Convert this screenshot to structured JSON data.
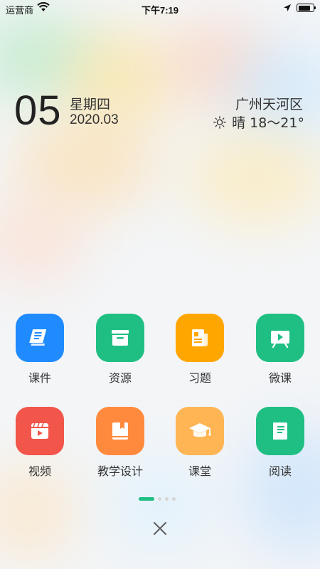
{
  "status": {
    "carrier": "运营商",
    "time": "下午7:19",
    "battery_level": 0.85
  },
  "header": {
    "day": "05",
    "weekday": "星期四",
    "year_month": "2020.03",
    "city": "广州天河区",
    "weather": "晴 18～21°",
    "weather_icon": "sun-icon"
  },
  "apps": [
    {
      "label": "课件",
      "icon": "book-icon",
      "color": "#1f8bff"
    },
    {
      "label": "资源",
      "icon": "archive-box-icon",
      "color": "#1fbf84"
    },
    {
      "label": "习题",
      "icon": "document-icon",
      "color": "#ffa600"
    },
    {
      "label": "微课",
      "icon": "play-board-icon",
      "color": "#1fbf84"
    },
    {
      "label": "视频",
      "icon": "video-clapper-icon",
      "color": "#f2554a"
    },
    {
      "label": "教学设计",
      "icon": "bookmark-book-icon",
      "color": "#ff8a3d"
    },
    {
      "label": "课堂",
      "icon": "graduation-cap-icon",
      "color": "#ffb554"
    },
    {
      "label": "阅读",
      "icon": "reading-book-icon",
      "color": "#1fbf84"
    }
  ],
  "pager": {
    "active_color": "#1fbf84",
    "pages": 4,
    "current": 1
  },
  "close_icon": "close-icon"
}
